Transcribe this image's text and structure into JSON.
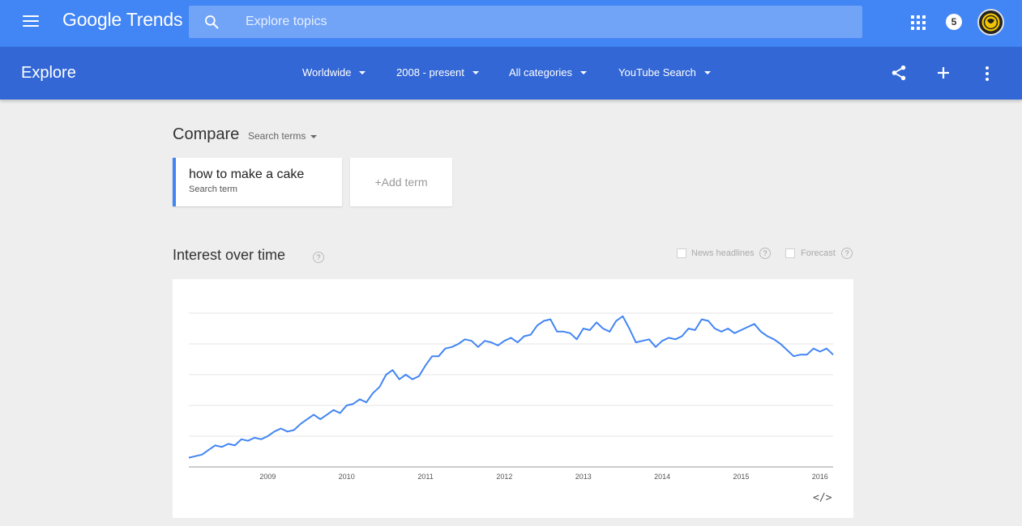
{
  "header": {
    "logo": "Google Trends",
    "search_placeholder": "Explore topics",
    "notification_count": "5"
  },
  "explore_bar": {
    "title": "Explore",
    "filters": [
      "Worldwide",
      "2008 - present",
      "All categories",
      "YouTube Search"
    ]
  },
  "compare": {
    "title": "Compare",
    "dropdown_label": "Search terms",
    "terms": [
      {
        "name": "how to make a cake",
        "type": "Search term",
        "color": "#4285f4"
      }
    ],
    "add_term_label": "+Add term"
  },
  "interest_over_time": {
    "title": "Interest over time",
    "help": "?",
    "toggles": [
      {
        "label": "News headlines",
        "help": "?"
      },
      {
        "label": "Forecast",
        "help": "?"
      }
    ],
    "embed_label": "</>"
  },
  "chart_data": {
    "type": "line",
    "x_labels": [
      "2009",
      "2010",
      "2011",
      "2012",
      "2013",
      "2014",
      "2015",
      "2016"
    ],
    "ylim": [
      0,
      100
    ],
    "grid": true,
    "series": [
      {
        "color": "#4285f4",
        "start": "2008-01",
        "interval": "monthly",
        "values": [
          6,
          7,
          8,
          11,
          14,
          13,
          15,
          14,
          18,
          17,
          19,
          18,
          20,
          23,
          25,
          23,
          24,
          28,
          31,
          34,
          31,
          34,
          37,
          35,
          40,
          41,
          44,
          42,
          48,
          52,
          60,
          63,
          57,
          60,
          57,
          59,
          66,
          72,
          72,
          77,
          78,
          80,
          83,
          82,
          78,
          82,
          81,
          79,
          82,
          84,
          81,
          85,
          86,
          92,
          95,
          96,
          88,
          88,
          87,
          83,
          90,
          89,
          94,
          90,
          88,
          95,
          98,
          90,
          81,
          82,
          83,
          78,
          82,
          84,
          83,
          85,
          90,
          89,
          96,
          95,
          90,
          88,
          90,
          87,
          89,
          91,
          93,
          88,
          85,
          83,
          80,
          76,
          72,
          73,
          73,
          77,
          75,
          77,
          73
        ]
      }
    ]
  }
}
